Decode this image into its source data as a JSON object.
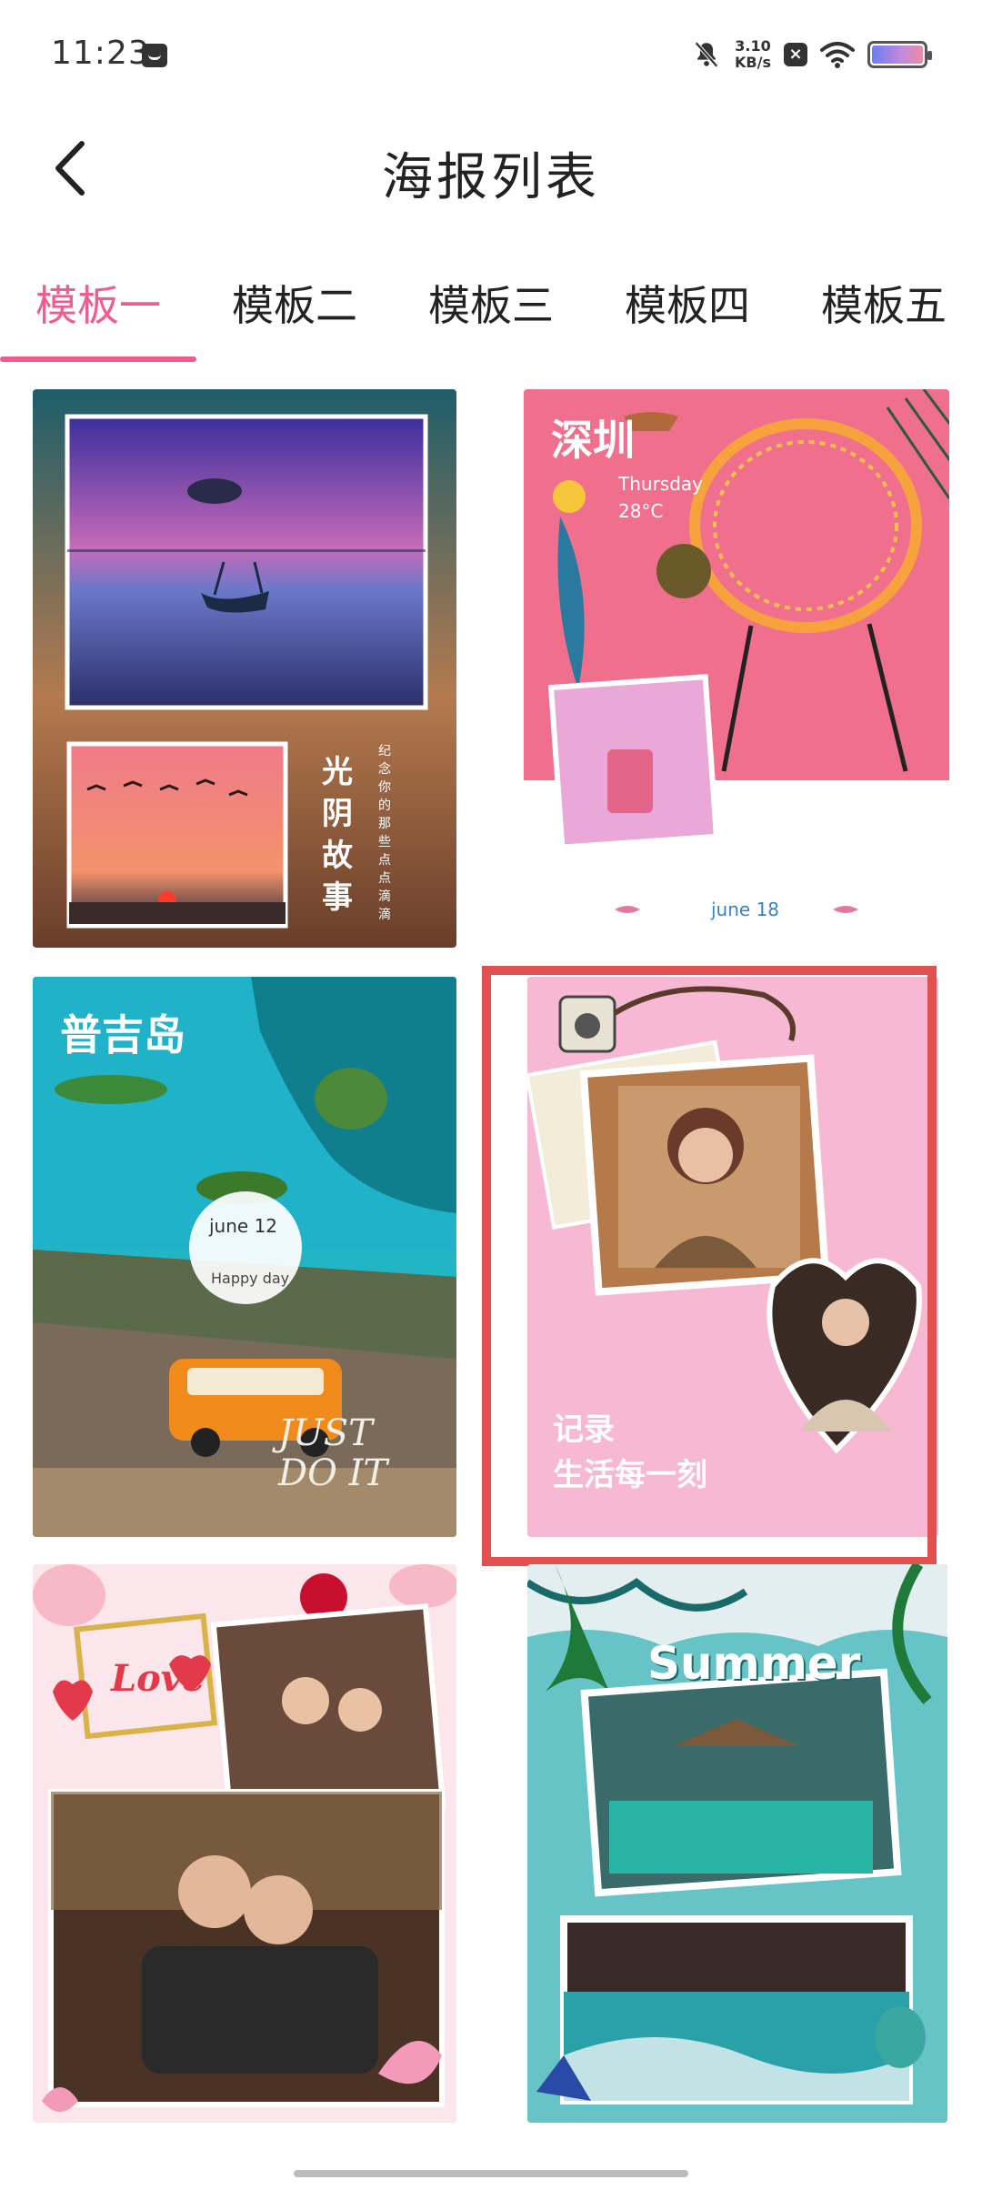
{
  "status": {
    "time": "11:23",
    "speed_value": "3.10",
    "speed_unit": "KB/s",
    "icons": [
      "message-icon",
      "bell-off-icon",
      "close-box-icon",
      "wifi-icon",
      "battery-icon"
    ]
  },
  "header": {
    "title": "海报列表",
    "back_icon": "chevron-left-icon"
  },
  "tabs": [
    {
      "label": "模板一",
      "active": true
    },
    {
      "label": "模板二",
      "active": false
    },
    {
      "label": "模板三",
      "active": false
    },
    {
      "label": "模板四",
      "active": false
    },
    {
      "label": "模板五",
      "active": false
    }
  ],
  "posters": [
    {
      "name": "poster-sunset",
      "vertical_text": "光阴故事",
      "small_text": "纪念你的那些点点滴滴"
    },
    {
      "name": "poster-shenzhen",
      "city": "深圳",
      "day": "Thursday",
      "temp": "28°C",
      "date": "june 18"
    },
    {
      "name": "poster-phuket",
      "title": "普吉岛",
      "date": "june 12",
      "sub": "Happy day",
      "script": "JUST DO IT"
    },
    {
      "name": "poster-record-life",
      "line1": "记录",
      "line2": "生活每一刻",
      "selected": true
    },
    {
      "name": "poster-love",
      "script": "Love"
    },
    {
      "name": "poster-summer",
      "title": "Summer"
    }
  ],
  "colors": {
    "accent": "#ee5d8b",
    "selection": "#e25050"
  }
}
